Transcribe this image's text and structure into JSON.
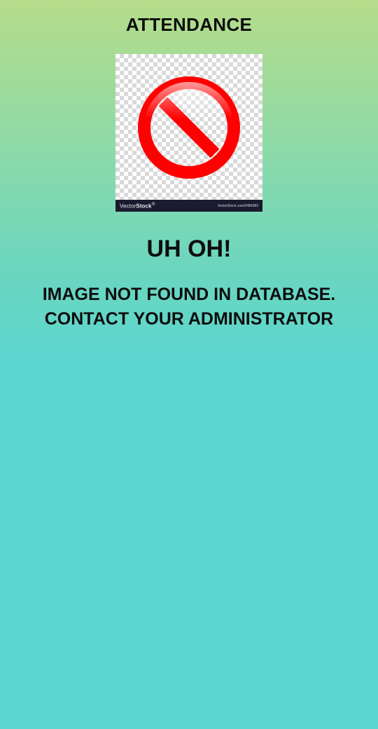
{
  "header": {
    "title": "ATTENDANCE"
  },
  "image": {
    "icon": "prohibited-icon",
    "watermark_brand_light": "Vector",
    "watermark_brand_bold": "Stock",
    "watermark_url": "VectorStock.com/2484383"
  },
  "error": {
    "heading": "UH OH!",
    "message_line1": "IMAGE NOT FOUND IN DATABASE.",
    "message_line2": "CONTACT YOUR ADMINISTRATOR"
  },
  "colors": {
    "gradient_top": "#b6dc8a",
    "gradient_bottom": "#5bd5cf",
    "prohibited_red": "#ff0000",
    "text": "#0d0d0d"
  }
}
